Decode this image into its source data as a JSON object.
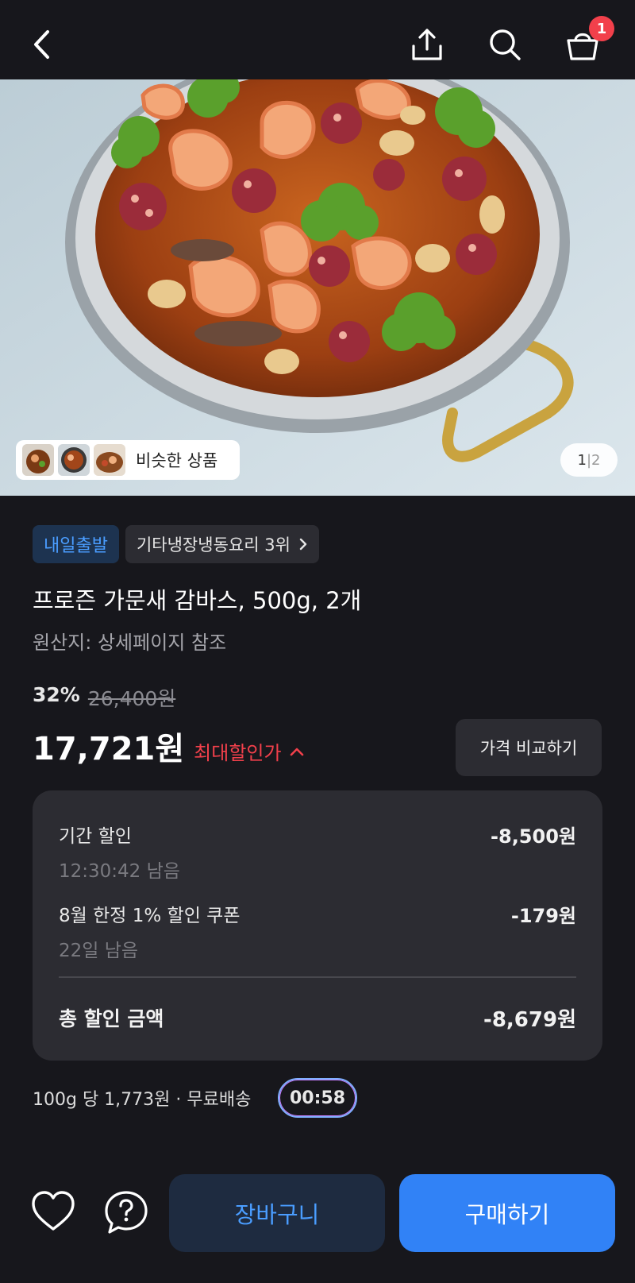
{
  "header": {
    "back_icon": "chevron-left-icon",
    "share_icon": "share-icon",
    "search_icon": "search-icon",
    "cart_icon": "cart-icon",
    "cart_badge": "1"
  },
  "gallery": {
    "similar_label": "비슷한 상품",
    "page_current": "1",
    "page_sep": "|",
    "page_total": "2"
  },
  "product": {
    "delivery_tag": "내일출발",
    "rank_tag": "기타냉장냉동요리 3위",
    "title": "프로즌 가문새 감바스, 500g, 2개",
    "origin": "원산지: 상세페이지 참조",
    "discount_pct": "32%",
    "original_price": "26,400원",
    "price": "17,721원",
    "max_discount_label": "최대할인가",
    "compare_button": "가격 비교하기"
  },
  "breakdown": {
    "items": [
      {
        "label": "기간 할인",
        "amount": "-8,500원",
        "sub": "12:30:42 남음"
      },
      {
        "label": "8월 한정 1% 할인 쿠폰",
        "amount": "-179원",
        "sub": "22일 남음"
      }
    ],
    "total_label": "총 할인 금액",
    "total_amount": "-8,679원"
  },
  "shipping": {
    "per_unit": "100g 당 1,773원 · 무료배송",
    "timer": "00:58"
  },
  "bottom_bar": {
    "heart_icon": "heart-icon",
    "help_icon": "question-icon",
    "cart_button": "장바구니",
    "buy_button": "구매하기"
  },
  "colors": {
    "background": "#17171c",
    "accent_blue": "#3182f6",
    "accent_red": "#f2404b",
    "card": "#2c2c32"
  }
}
